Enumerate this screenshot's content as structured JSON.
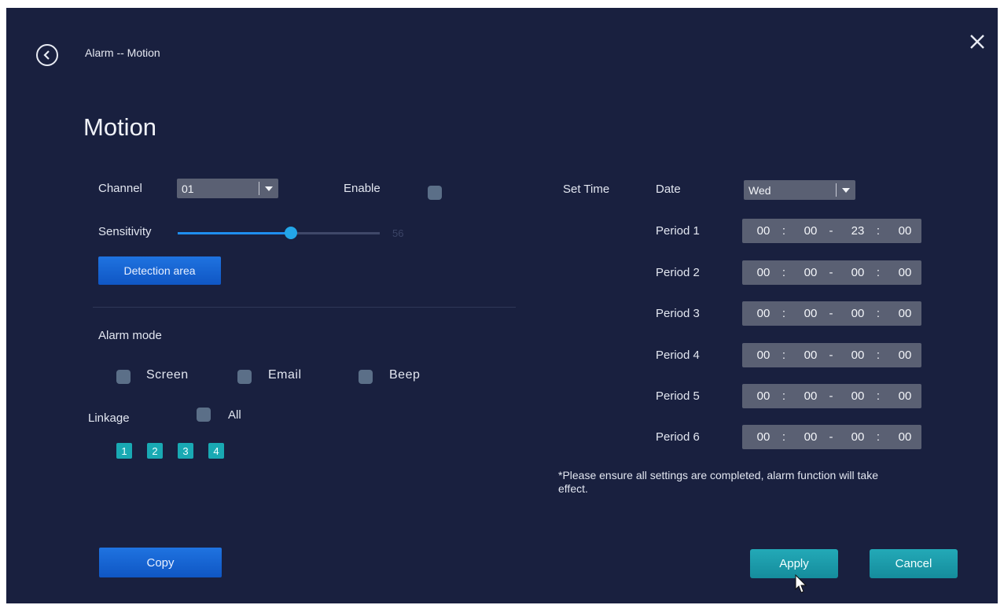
{
  "header": {
    "breadcrumb": "Alarm -- Motion",
    "title": "Motion"
  },
  "colors": {
    "background": "#19203f",
    "accent_blue": "#1f73e0",
    "accent_teal": "#19a9b3",
    "field": "#5a6073"
  },
  "left": {
    "channel_label": "Channel",
    "channel_value": "01",
    "enable_label": "Enable",
    "enable_checked": false,
    "sensitivity_label": "Sensitivity",
    "sensitivity_value": "56",
    "detection_area_label": "Detection area",
    "alarm_mode_label": "Alarm mode",
    "alarm_modes": [
      {
        "label": "Screen",
        "checked": false
      },
      {
        "label": "Email",
        "checked": false
      },
      {
        "label": "Beep",
        "checked": false
      }
    ],
    "linkage_label": "Linkage",
    "linkage_all_label": "All",
    "linkage_channels": [
      "1",
      "2",
      "3",
      "4"
    ],
    "copy_label": "Copy"
  },
  "right": {
    "set_time_label": "Set Time",
    "date_label": "Date",
    "date_value": "Wed",
    "periods": [
      {
        "label": "Period 1",
        "start_h": "00",
        "start_m": "00",
        "end_h": "23",
        "end_m": "00"
      },
      {
        "label": "Period 2",
        "start_h": "00",
        "start_m": "00",
        "end_h": "00",
        "end_m": "00"
      },
      {
        "label": "Period 3",
        "start_h": "00",
        "start_m": "00",
        "end_h": "00",
        "end_m": "00"
      },
      {
        "label": "Period 4",
        "start_h": "00",
        "start_m": "00",
        "end_h": "00",
        "end_m": "00"
      },
      {
        "label": "Period 5",
        "start_h": "00",
        "start_m": "00",
        "end_h": "00",
        "end_m": "00"
      },
      {
        "label": "Period 6",
        "start_h": "00",
        "start_m": "00",
        "end_h": "00",
        "end_m": "00"
      }
    ],
    "note": "*Please ensure all settings are completed, alarm function will take effect.",
    "apply_label": "Apply",
    "cancel_label": "Cancel"
  },
  "icons": {
    "back": "back-arrow-icon",
    "close": "close-icon",
    "dropdown": "caret-down-icon",
    "cursor": "mouse-pointer-icon"
  }
}
